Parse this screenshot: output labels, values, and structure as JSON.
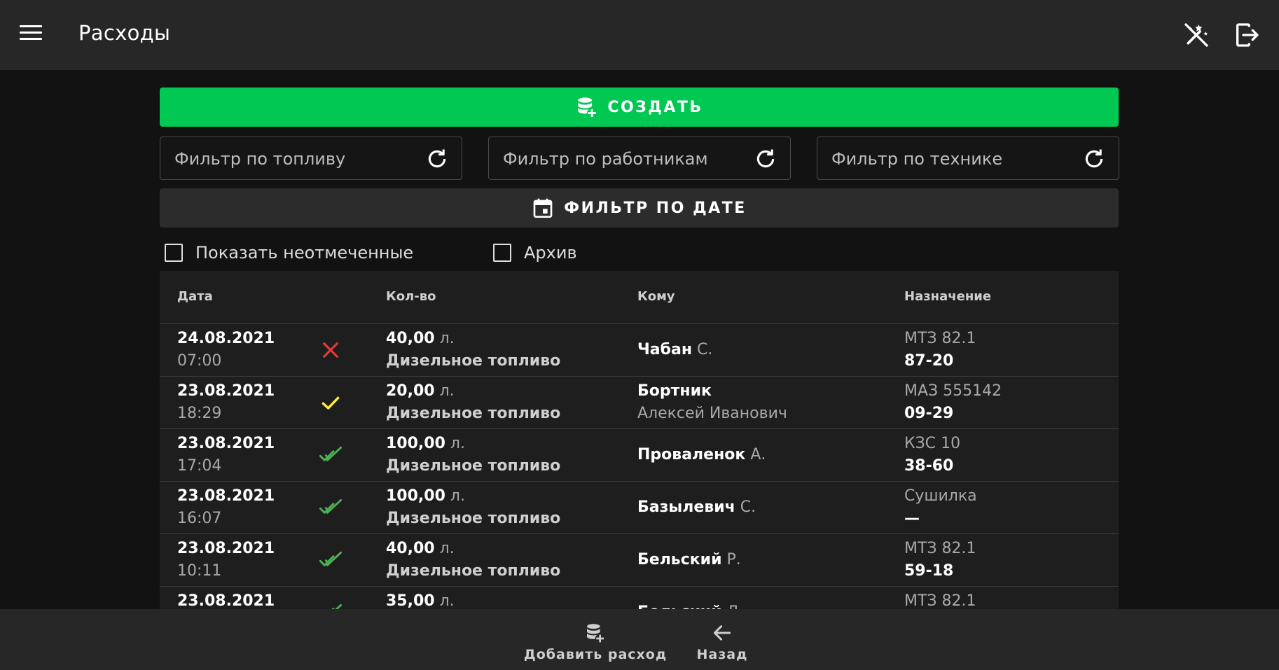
{
  "header": {
    "title": "Расходы"
  },
  "actions": {
    "create_label": "СОЗДАТЬ",
    "date_filter_label": "ФИЛЬТР ПО ДАТЕ"
  },
  "filters": {
    "fuel_placeholder": "Фильтр по топливу",
    "workers_placeholder": "Фильтр по работникам",
    "equipment_placeholder": "Фильтр по технике"
  },
  "checkboxes": {
    "show_unmarked": "Показать неотмеченные",
    "archive": "Архив"
  },
  "table": {
    "headers": {
      "date": "Дата",
      "qty": "Кол-во",
      "to": "Кому",
      "purpose": "Назначение"
    },
    "rows": [
      {
        "date": "24.08.2021",
        "time": "07:00",
        "status": "rejected",
        "qty": "40,00",
        "unit": "л.",
        "fuel": "Дизельное топливо",
        "surname": "Чабан",
        "initial": "С.",
        "name2": "",
        "vehicle": "МТЗ 82.1",
        "code": "87-20"
      },
      {
        "date": "23.08.2021",
        "time": "18:29",
        "status": "checked",
        "qty": "20,00",
        "unit": "л.",
        "fuel": "Дизельное топливо",
        "surname": "Бортник",
        "initial": "",
        "name2": "Алексей Иванович",
        "vehicle": "МАЗ 555142",
        "code": "09-29"
      },
      {
        "date": "23.08.2021",
        "time": "17:04",
        "status": "confirmed",
        "qty": "100,00",
        "unit": "л.",
        "fuel": "Дизельное топливо",
        "surname": "Проваленок",
        "initial": "А.",
        "name2": "",
        "vehicle": "КЗС 10",
        "code": "38-60"
      },
      {
        "date": "23.08.2021",
        "time": "16:07",
        "status": "confirmed",
        "qty": "100,00",
        "unit": "л.",
        "fuel": "Дизельное топливо",
        "surname": "Базылевич",
        "initial": "С.",
        "name2": "",
        "vehicle": "Сушилка",
        "code": "—"
      },
      {
        "date": "23.08.2021",
        "time": "10:11",
        "status": "confirmed",
        "qty": "40,00",
        "unit": "л.",
        "fuel": "Дизельное топливо",
        "surname": "Бельский",
        "initial": "Р.",
        "name2": "",
        "vehicle": "МТЗ 82.1",
        "code": "59-18"
      },
      {
        "date": "23.08.2021",
        "time": "",
        "status": "confirmed",
        "qty": "35,00",
        "unit": "л.",
        "fuel": "",
        "surname": "Бельский",
        "initial": "Л.",
        "name2": "",
        "vehicle": "МТЗ 82.1",
        "code": ""
      }
    ]
  },
  "bottom_nav": {
    "add_label": "Добавить расход",
    "back_label": "Назад"
  },
  "colors": {
    "accent_green": "#00c853",
    "status_rejected": "#e53935",
    "status_checked": "#ffeb3b",
    "status_confirmed": "#4caf50"
  },
  "icons": {
    "menu": "menu-icon",
    "theme": "magic-wand-off-icon",
    "logout": "logout-icon",
    "create": "database-plus-icon",
    "refresh": "refresh-icon",
    "calendar": "calendar-icon",
    "back": "arrow-left-icon"
  }
}
